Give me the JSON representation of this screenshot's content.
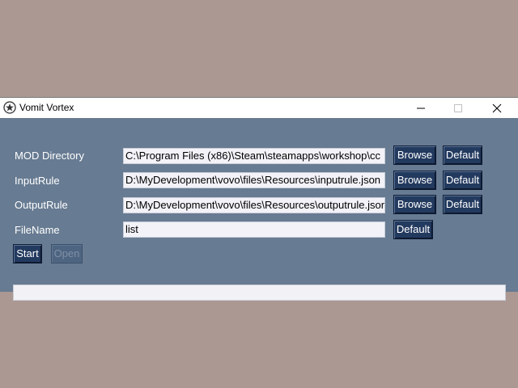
{
  "window": {
    "title": "Vomit Vortex",
    "controls": {
      "minimize_icon": "minimize-icon",
      "maximize_icon": "maximize-icon",
      "close_icon": "close-icon"
    }
  },
  "form": {
    "mod_directory": {
      "label": "MOD Directory",
      "value": "C:\\Program Files (x86)\\Steam\\steamapps\\workshop\\cc",
      "browse_label": "Browse",
      "default_label": "Default"
    },
    "input_rule": {
      "label": "InputRule",
      "value": "D:\\MyDevelopment\\vovo\\files\\Resources\\inputrule.json",
      "browse_label": "Browse",
      "default_label": "Default"
    },
    "output_rule": {
      "label": "OutputRule",
      "value": "D:\\MyDevelopment\\vovo\\files\\Resources\\outputrule.json",
      "browse_label": "Browse",
      "default_label": "Default"
    },
    "file_name": {
      "label": "FileName",
      "value": "list",
      "default_label": "Default"
    }
  },
  "actions": {
    "start_label": "Start",
    "open_label": "Open",
    "open_enabled": false
  },
  "status": {
    "text": ""
  },
  "colors": {
    "desktop": "#ab9892",
    "client_bg": "#677b92",
    "button_bg": "#233a5f",
    "button_text": "#ffffff",
    "field_bg": "#f2f2f8"
  }
}
